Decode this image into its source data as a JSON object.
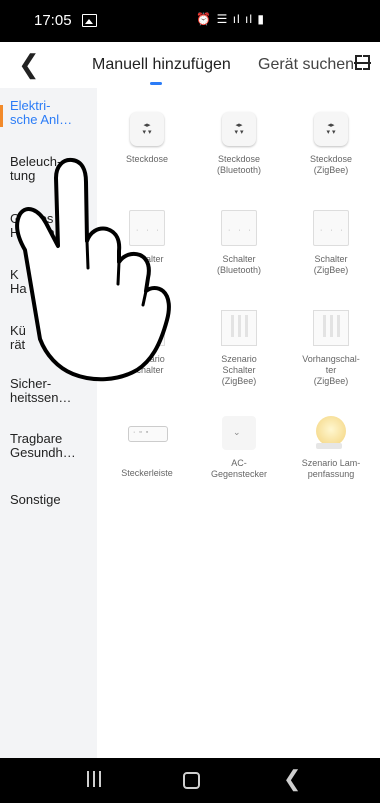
{
  "status_bar": {
    "time": "17:05",
    "right_icons": "⏰ ☰ ıl ıl ▮"
  },
  "header": {
    "back_icon": "chevron-left-icon",
    "tabs": [
      {
        "label": "Manuell hinzufügen",
        "active": true
      },
      {
        "label": "Gerät suchen",
        "active": false
      }
    ],
    "scan_icon": "scan-icon",
    "accent_color": "#2b7cf7"
  },
  "sidebar": {
    "items": [
      {
        "label": "Elektri-\nsche Anl…",
        "active": true
      },
      {
        "label": "Beleuch-\ntung"
      },
      {
        "label": "Großes\nHaushalt…"
      },
      {
        "label": "K\nHa"
      },
      {
        "label": "Kü\nrät"
      },
      {
        "label": "Sicher-\nheitssen…"
      },
      {
        "label": "Tragbare\nGesundh…"
      },
      {
        "label": "Sonstige"
      }
    ],
    "active_marker_color": "#f28a2a"
  },
  "devices": [
    {
      "name": "Steckdose",
      "icon": "socket-icon"
    },
    {
      "name": "Steckdose\n(Bluetooth)",
      "icon": "socket-icon"
    },
    {
      "name": "Steckdose\n(ZigBee)",
      "icon": "socket-icon"
    },
    {
      "name": "Schalter",
      "icon": "switch-icon"
    },
    {
      "name": "Schalter\n(Bluetooth)",
      "icon": "switch-icon"
    },
    {
      "name": "Schalter\n(ZigBee)",
      "icon": "switch-icon"
    },
    {
      "name": "Szenario\nSchalter",
      "icon": "scenario-switch-icon"
    },
    {
      "name": "Szenario\nSchalter\n(ZigBee)",
      "icon": "scenario-switch-icon"
    },
    {
      "name": "Vorhangschal-\nter\n(ZigBee)",
      "icon": "curtain-switch-icon"
    },
    {
      "name": "Steckerleiste",
      "icon": "power-strip-icon"
    },
    {
      "name": "AC-\nGegenstecker",
      "icon": "ac-plug-icon"
    },
    {
      "name": "Szenario Lam-\npenfassung",
      "icon": "lamp-socket-icon"
    }
  ],
  "nav_bar": {
    "recent_icon": "recent-apps-icon",
    "home_icon": "home-icon",
    "back_icon": "back-icon"
  }
}
